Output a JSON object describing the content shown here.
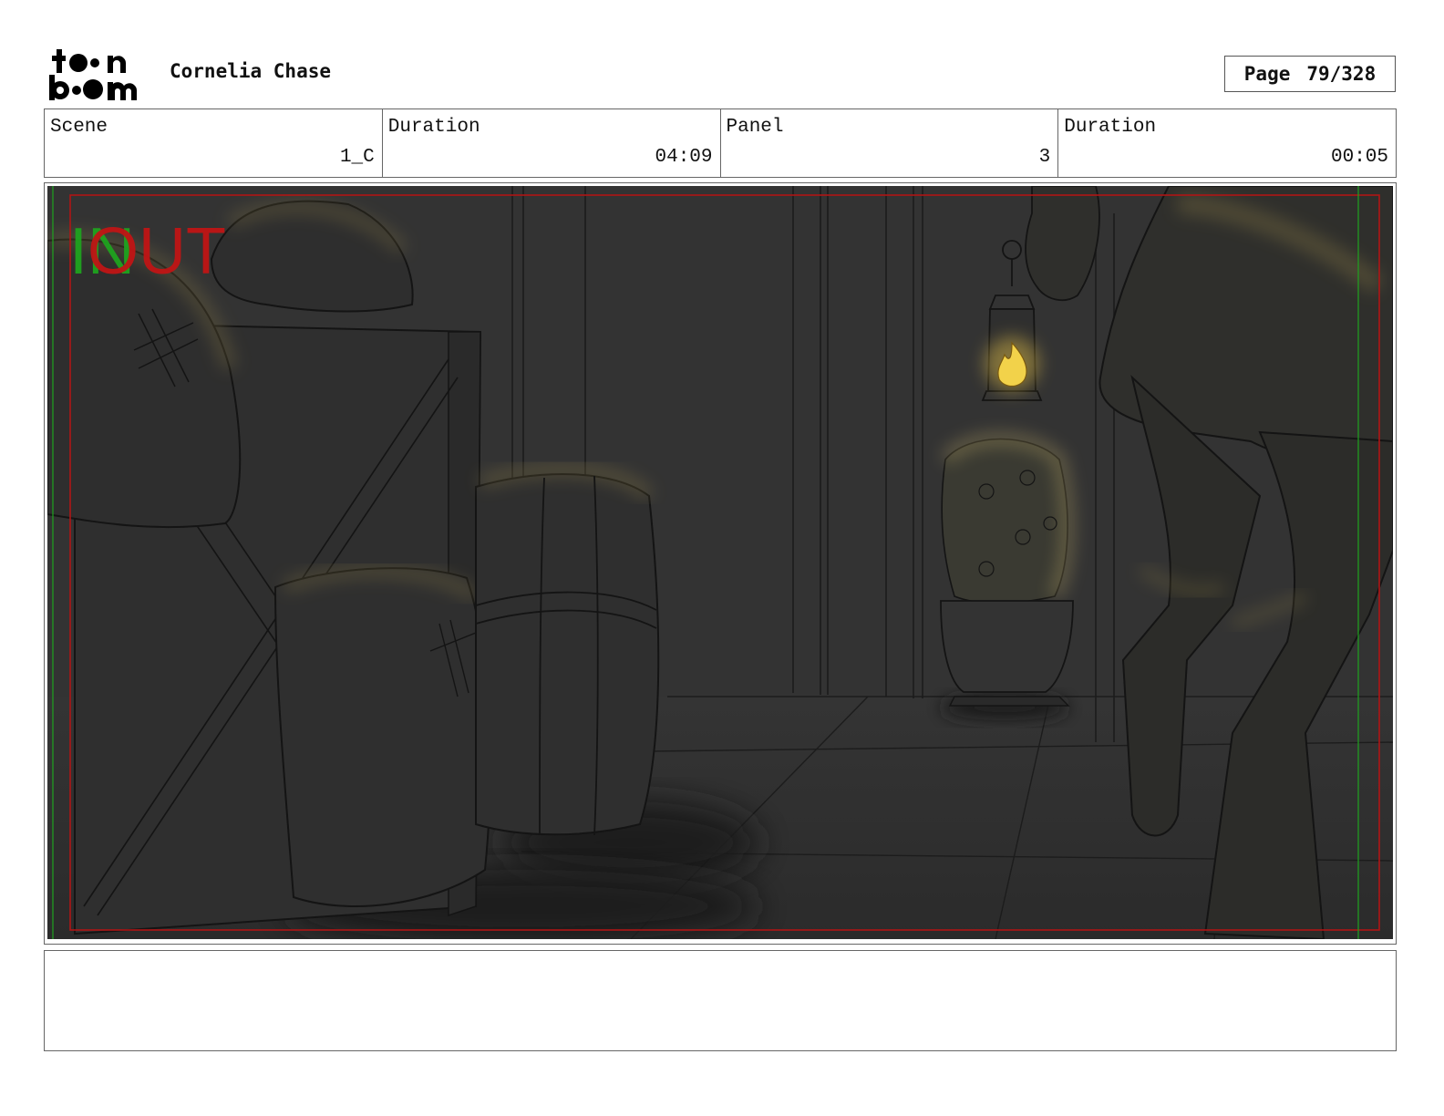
{
  "header": {
    "logo_text_top": "toon",
    "logo_text_bottom": "boom",
    "project_title": "Cornelia Chase",
    "page_label": "Page",
    "page_value": "79/328"
  },
  "info": [
    {
      "label": "Scene",
      "value": "1_C"
    },
    {
      "label": "Duration",
      "value": "04:09"
    },
    {
      "label": "Panel",
      "value": "3"
    },
    {
      "label": "Duration",
      "value": "00:05"
    }
  ],
  "panel": {
    "in_marker": "IN",
    "out_marker": "OUT",
    "colors": {
      "background": "#333333",
      "in_marker": "#1fa31f",
      "out_marker": "#c01515",
      "glow": "#c9b46a"
    }
  },
  "notes": {
    "text": ""
  }
}
